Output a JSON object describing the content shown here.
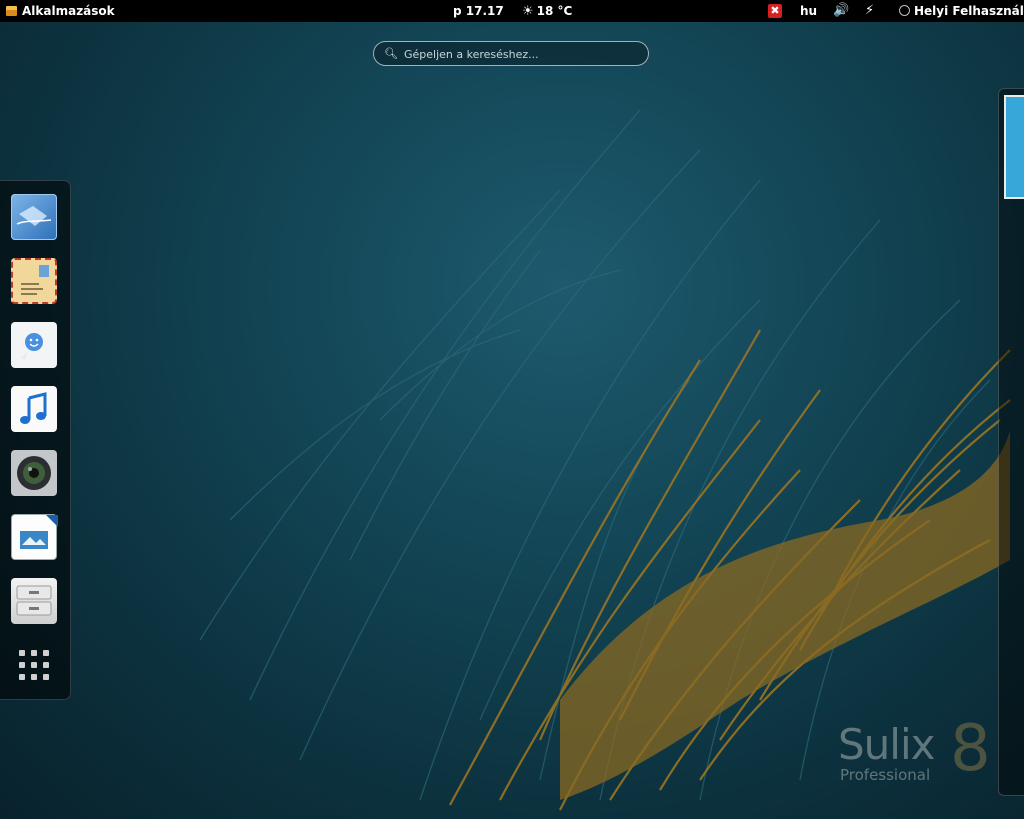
{
  "topbar": {
    "apps_label": "Alkalmazások",
    "clock": "p 17.17",
    "weather": "18 °C",
    "language": "hu",
    "user": "Helyi Felhasználó"
  },
  "search": {
    "placeholder": "Gépeljen a kereséshez..."
  },
  "dash": {
    "favorites": [
      {
        "icon": "web-browser-icon"
      },
      {
        "icon": "mail-icon"
      },
      {
        "icon": "chat-icon"
      },
      {
        "icon": "music-icon"
      },
      {
        "icon": "camera-icon"
      },
      {
        "icon": "presentation-icon"
      },
      {
        "icon": "file-manager-icon"
      },
      {
        "icon": "show-applications-icon"
      }
    ]
  },
  "logo": {
    "name": "Sulix",
    "edition": "Professional",
    "version": "8"
  }
}
